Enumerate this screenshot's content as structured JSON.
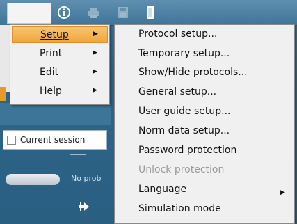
{
  "main_menu": {
    "items": [
      {
        "label": "Setup",
        "has_submenu": true,
        "active": true
      },
      {
        "label": "Print",
        "has_submenu": true,
        "active": false
      },
      {
        "label": "Edit",
        "has_submenu": true,
        "active": false
      },
      {
        "label": "Help",
        "has_submenu": true,
        "active": false
      }
    ],
    "submenu_arrow": "▶"
  },
  "setup_submenu": {
    "items": [
      {
        "label": "Protocol setup...",
        "enabled": true
      },
      {
        "label": "Temporary setup...",
        "enabled": true
      },
      {
        "label": "Show/Hide protocols...",
        "enabled": true
      },
      {
        "label": "General setup...",
        "enabled": true
      },
      {
        "label": "User guide setup...",
        "enabled": true
      },
      {
        "label": "Norm data setup...",
        "enabled": true
      },
      {
        "label": "Password protection",
        "enabled": true
      },
      {
        "label": "Unlock protection",
        "enabled": false
      },
      {
        "label": "Language",
        "enabled": true,
        "has_submenu": true
      },
      {
        "label": "Simulation mode",
        "enabled": true
      }
    ],
    "submenu_arrow": "▶"
  },
  "session": {
    "label": "Current session",
    "checked": false
  },
  "probe": {
    "status_text": "No prob"
  },
  "toolbar": {
    "icons": [
      "info-icon",
      "print-icon",
      "save-icon",
      "exit-icon"
    ]
  },
  "colors": {
    "background": "#2f6a8d",
    "menu_bg": "#f0f0f0",
    "highlight": "#f0a53b",
    "disabled_text": "#9a9a9a"
  }
}
